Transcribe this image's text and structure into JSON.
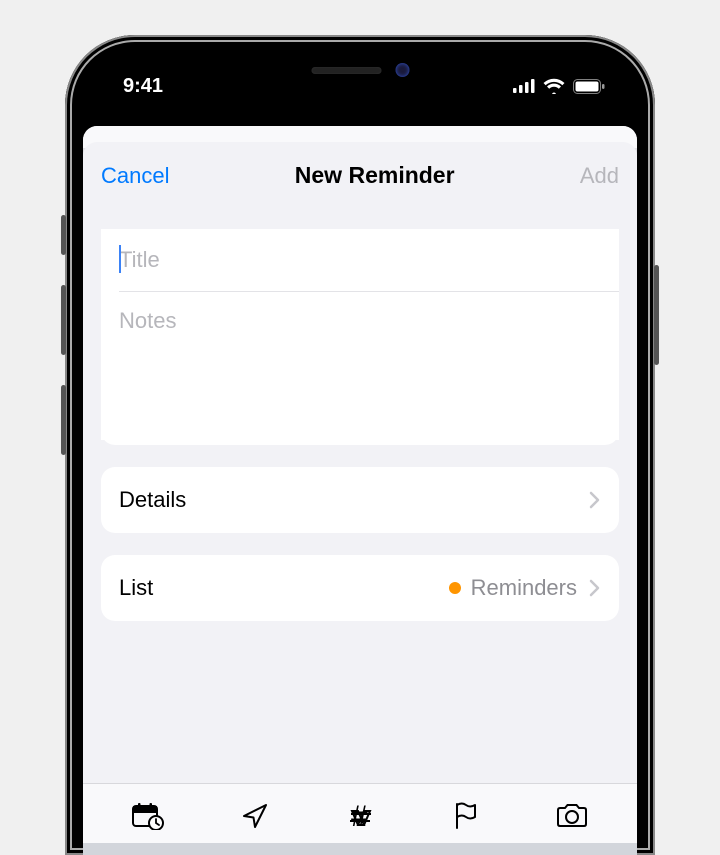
{
  "statusBar": {
    "time": "9:41"
  },
  "nav": {
    "cancel": "Cancel",
    "title": "New Reminder",
    "add": "Add"
  },
  "form": {
    "titlePlaceholder": "Title",
    "titleValue": "",
    "notesPlaceholder": "Notes",
    "notesValue": ""
  },
  "rows": {
    "details": {
      "label": "Details"
    },
    "list": {
      "label": "List",
      "value": "Reminders",
      "dotColor": "#ff9500"
    }
  },
  "toolbar": {
    "icons": [
      "calendar-clock-icon",
      "location-icon",
      "tag-icon",
      "flag-icon",
      "camera-icon"
    ]
  }
}
